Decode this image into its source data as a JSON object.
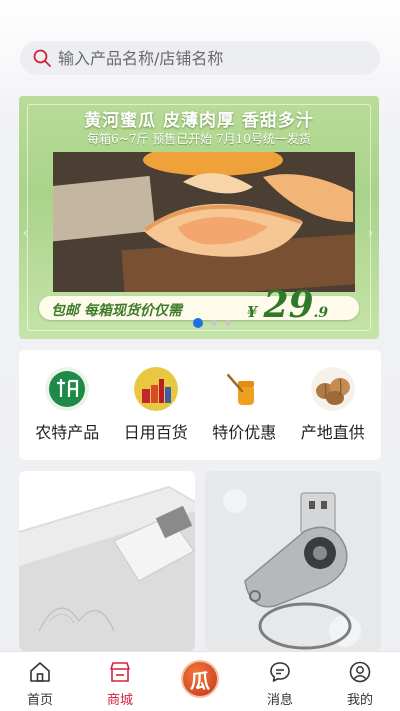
{
  "search": {
    "placeholder": "输入产品名称/店铺名称"
  },
  "banner": {
    "headline": "黄河蜜瓜 皮薄肉厚 香甜多汁",
    "subline": "每箱6~7斤 预售已开始 7月10号统一发货",
    "price_text": "包邮  每箱现货价仅需",
    "currency": "¥",
    "price_int": "29",
    "price_dec": ".9",
    "slides": 3,
    "active_slide": 1
  },
  "categories": [
    {
      "label": "农特产品",
      "icon": "local-specialty-icon"
    },
    {
      "label": "日用百货",
      "icon": "daily-goods-icon"
    },
    {
      "label": "特价优惠",
      "icon": "special-offer-icon"
    },
    {
      "label": "产地直供",
      "icon": "origin-direct-icon"
    }
  ],
  "products": [
    {
      "name": "usb-card-product",
      "icon": "usb-card-icon"
    },
    {
      "name": "usb-swivel-product",
      "icon": "usb-swivel-icon"
    }
  ],
  "tabbar": {
    "items": [
      {
        "label": "首页",
        "icon": "home-icon",
        "active": false
      },
      {
        "label": "商城",
        "icon": "shop-icon",
        "active": true
      },
      {
        "label": "",
        "icon": "brand-logo-icon",
        "glyph": "瓜",
        "active": false
      },
      {
        "label": "消息",
        "icon": "message-icon",
        "active": false
      },
      {
        "label": "我的",
        "icon": "profile-icon",
        "active": false
      }
    ]
  },
  "colors": {
    "accent": "#d6213b",
    "indicator": "#1f6fe5",
    "banner_green": "#a9d38a",
    "price_green": "#2e7a2a"
  }
}
